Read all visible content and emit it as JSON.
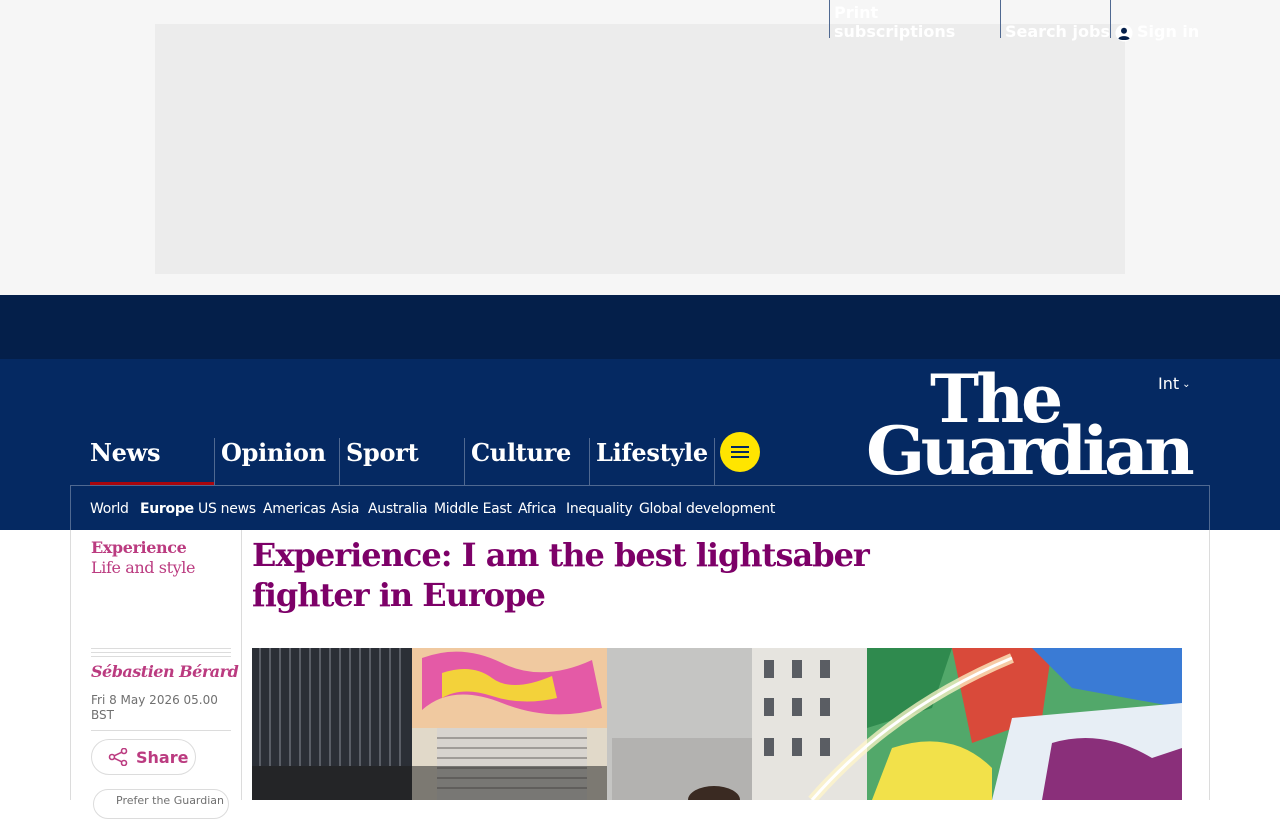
{
  "topbar": {
    "print_subscriptions": "Print subscriptions",
    "search_jobs": "Search jobs",
    "sign_in": "Sign in"
  },
  "header": {
    "edition": "Int",
    "logo_text": [
      "The",
      "Guardian"
    ]
  },
  "pillars": [
    {
      "label": "News"
    },
    {
      "label": "Opinion"
    },
    {
      "label": "Sport"
    },
    {
      "label": "Culture"
    },
    {
      "label": "Lifestyle"
    }
  ],
  "subnav": [
    {
      "label": "World"
    },
    {
      "label": "Europe"
    },
    {
      "label": "US news"
    },
    {
      "label": "Americas"
    },
    {
      "label": "Asia"
    },
    {
      "label": "Australia"
    },
    {
      "label": "Middle East"
    },
    {
      "label": "Africa"
    },
    {
      "label": "Inequality"
    },
    {
      "label": "Global development"
    }
  ],
  "article": {
    "series": "Experience",
    "section": "Life and style",
    "headline": "Experience: I am the best lightsaber fighter in Europe",
    "byline": "Sébastien Bérard",
    "date": "Fri 8 May 2026 05.00 BST",
    "share_label": "Share",
    "prefer_label": "Prefer the Guardian"
  },
  "colors": {
    "brand_dark": "#041f4a",
    "brand": "#052962",
    "accent_yellow": "#ffe500",
    "lifestyle": "#bb3b80",
    "headline": "#7d0068"
  }
}
